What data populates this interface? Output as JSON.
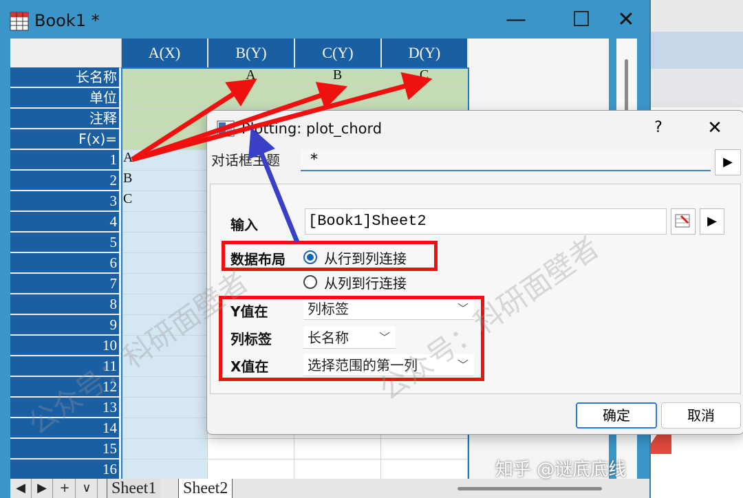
{
  "window": {
    "title": "Book1 *",
    "minimize_glyph": "—",
    "maximize_glyph": "☐",
    "close_glyph": "✕"
  },
  "sheet": {
    "columns": [
      "A(X)",
      "B(Y)",
      "C(Y)",
      "D(Y)"
    ],
    "meta_rows": [
      "长名称",
      "单位",
      "注释",
      "F(x)="
    ],
    "long_names": [
      "",
      "A",
      "B",
      "C"
    ],
    "row_numbers": [
      "1",
      "2",
      "3",
      "4",
      "5",
      "6",
      "7",
      "8",
      "9",
      "10",
      "11",
      "12",
      "13",
      "14",
      "15",
      "16"
    ],
    "col_a_values": [
      "A",
      "B",
      "C"
    ]
  },
  "tabs": {
    "nav": [
      "◀",
      "▶",
      "+",
      "∨"
    ],
    "sheets": [
      "Sheet1",
      "Sheet2"
    ],
    "active": "Sheet2"
  },
  "dialog": {
    "title": "Plotting: plot_chord",
    "help": "?",
    "close": "✕",
    "theme_label": "对话框主题",
    "theme_value": "*",
    "input_label": "输入",
    "input_value": "[Book1]Sheet2",
    "layout_label": "数据布局",
    "layout_options": [
      "从行到列连接",
      "从列到行连接"
    ],
    "layout_selected": "从行到列连接",
    "y_label": "Y值在",
    "y_value": "列标签",
    "col_label": "列标签",
    "col_value": "长名称",
    "x_label": "X值在",
    "x_value": "选择范围的第一列",
    "ok": "确定",
    "cancel": "取消"
  },
  "watermarks": {
    "text1": "公众号：科研面壁者",
    "text2": "公众号：科研面壁者",
    "bottom": "知乎 @谜底底线"
  },
  "colors": {
    "header_blue": "#1b5fa3",
    "meta_green": "#c4dbb3",
    "annotation_red": "#ef1010",
    "annotation_blue": "#3a3fc8"
  },
  "icons": {
    "book": "spreadsheet-icon",
    "dialog": "plot-icon",
    "arrow_right": "play-arrow-icon"
  }
}
